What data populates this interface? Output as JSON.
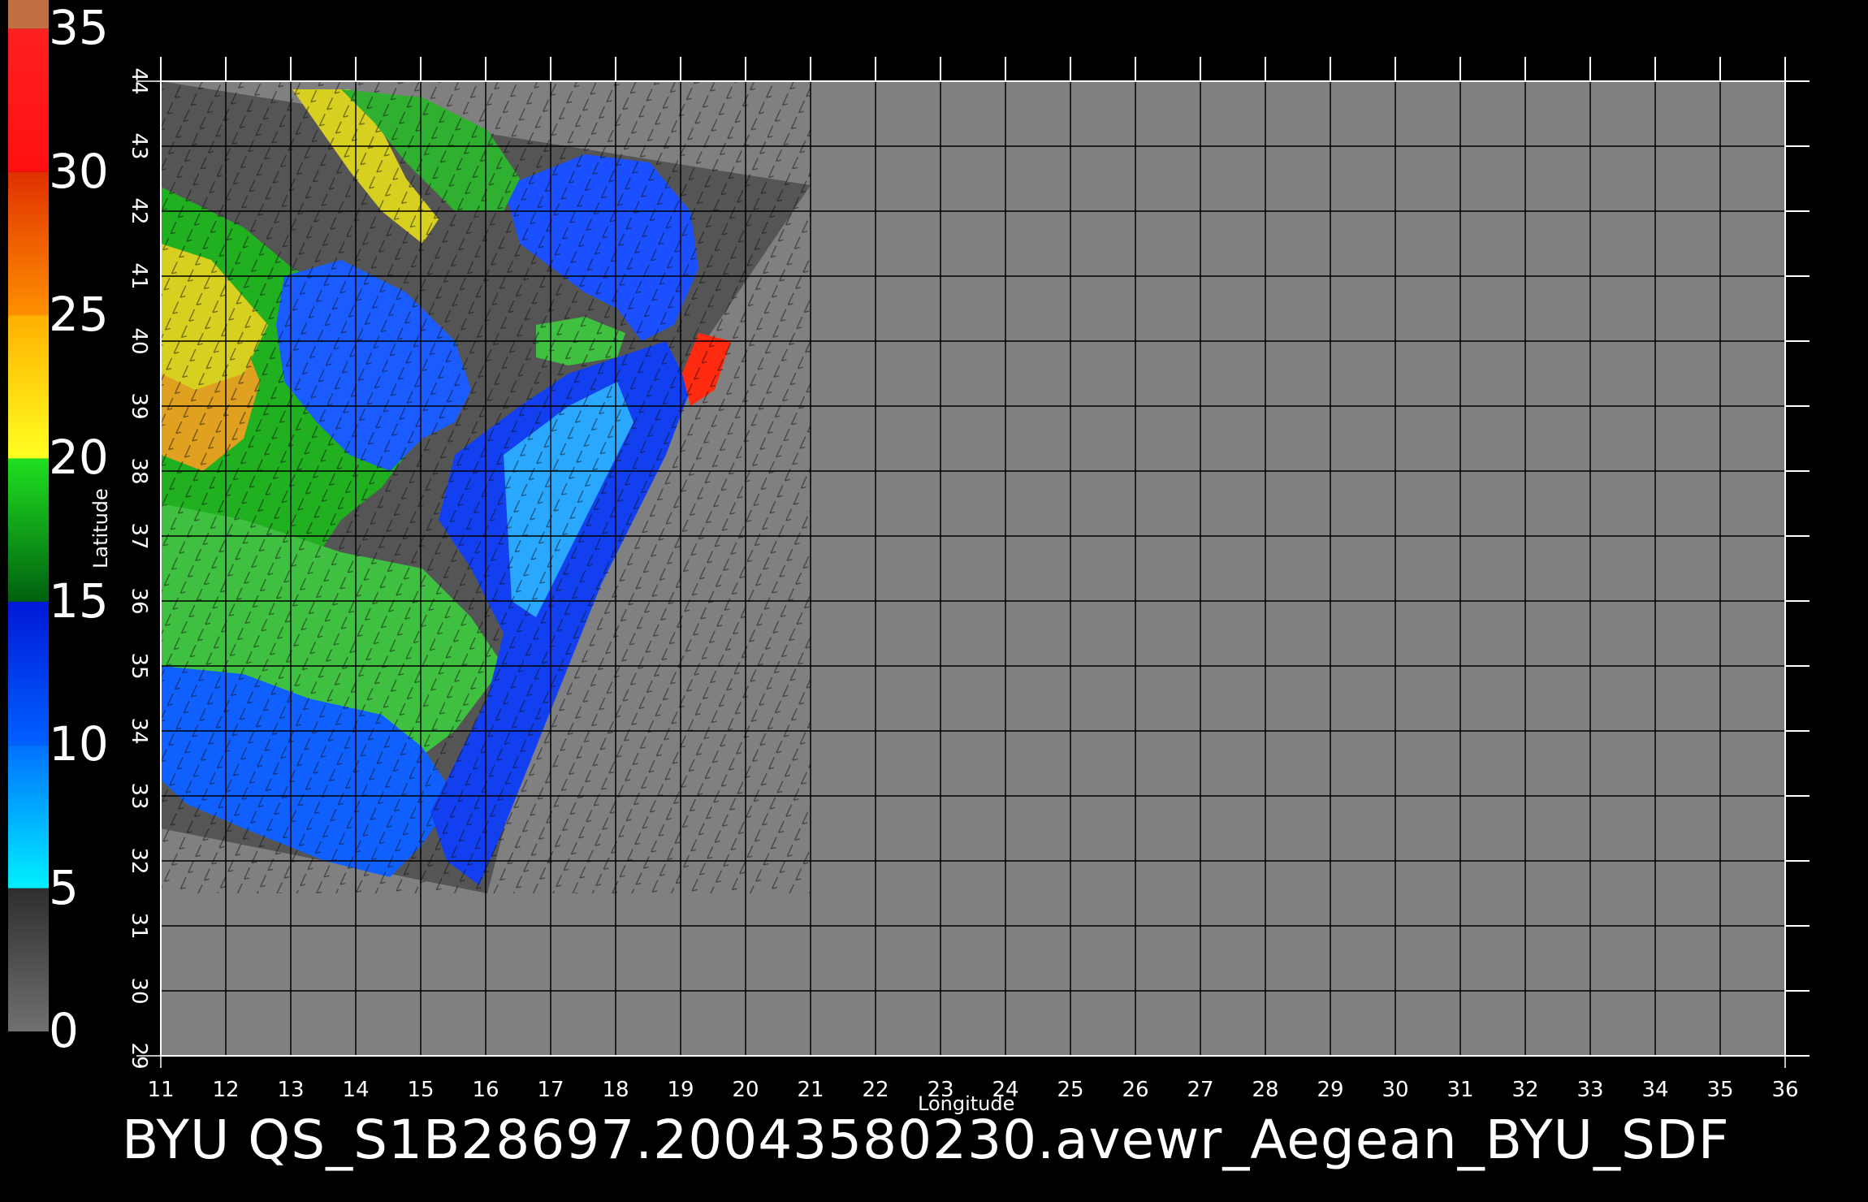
{
  "colorbar": {
    "labels": [
      "35",
      "30",
      "25",
      "20",
      "15",
      "10",
      "5",
      "0"
    ],
    "bands": [
      {
        "from": 0,
        "to": 5,
        "colors": [
          "#707070",
          "#2e2e2e"
        ]
      },
      {
        "from": 5,
        "to": 10,
        "colors": [
          "#00f0ff",
          "#0070ff"
        ]
      },
      {
        "from": 10,
        "to": 15,
        "colors": [
          "#0060ff",
          "#0018d8"
        ]
      },
      {
        "from": 15,
        "to": 20,
        "colors": [
          "#006010",
          "#20e020"
        ]
      },
      {
        "from": 20,
        "to": 25,
        "colors": [
          "#ffff20",
          "#ffb000"
        ]
      },
      {
        "from": 25,
        "to": 30,
        "colors": [
          "#ff9000",
          "#e03000"
        ]
      },
      {
        "from": 30,
        "to": 35,
        "colors": [
          "#ff1010",
          "#ff2020"
        ]
      },
      {
        "from": 35,
        "to": 36,
        "colors": [
          "#c07040",
          "#c07040"
        ]
      }
    ]
  },
  "map": {
    "lon_ticks": [
      "11",
      "12",
      "13",
      "14",
      "15",
      "16",
      "17",
      "18",
      "19",
      "20",
      "21",
      "22",
      "23",
      "24",
      "25",
      "26",
      "27",
      "28",
      "29",
      "30",
      "31",
      "32",
      "33",
      "34",
      "35",
      "36"
    ],
    "lat_ticks": [
      "29",
      "30",
      "31",
      "32",
      "33",
      "34",
      "35",
      "36",
      "37",
      "38",
      "39",
      "40",
      "41",
      "42",
      "43",
      "44"
    ],
    "xlabel": "Longitude",
    "ylabel": "Latitude",
    "background_color": "#808080",
    "no_data_color": "#555555",
    "grid_color": "#000000"
  },
  "caption": "BYU  QS_S1B28697.20043580230.avewr_Aegean_BYU_SDF"
}
